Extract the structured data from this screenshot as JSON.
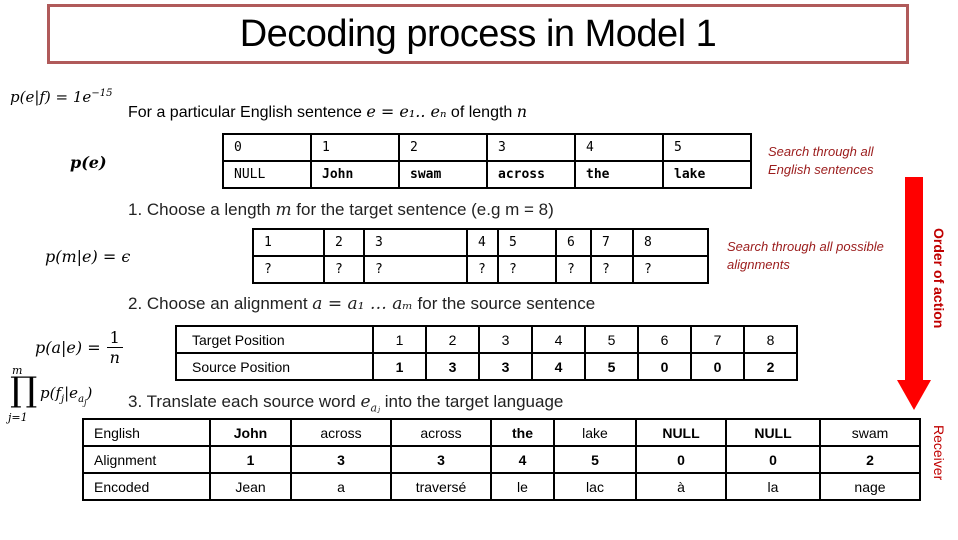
{
  "title": "Decoding process in Model 1",
  "formulas": {
    "p_e_given_f": "p(e|f) = 1e",
    "p_e_given_f_exp": "−15",
    "p_e": "p(e)",
    "p_m_given_e": "p(m|e) = ϵ",
    "p_a_given_e": "p(a|e) =",
    "p_a_num": "1",
    "p_a_den": "n",
    "prod_top": "m",
    "prod_symbol": "∏",
    "prod_bottom": "j=1",
    "prod_term": "p(f",
    "prod_term_sub": "j",
    "prod_term_rest": "|e",
    "prod_term_sub2": "a",
    "prod_term_sub3": "j",
    "prod_term_close": ")"
  },
  "intro": {
    "text": "For a particular English sentence ",
    "math": "e  =  e₁.. eₙ",
    "suffix": " of length ",
    "n": "n"
  },
  "steps": {
    "step1_prefix": "1. Choose a length ",
    "step1_var": "m",
    "step1_suffix": " for the target sentence (e.g m = 8)",
    "step2_prefix": "2. Choose an alignment ",
    "step2_math": "a =  a₁ … aₘ",
    "step2_suffix": " for the source sentence",
    "step3_prefix": "3. Translate each source word ",
    "step3_math": "e",
    "step3_sub": "aⱼ",
    "step3_suffix": " into the target language"
  },
  "english_table": {
    "indices": [
      "0",
      "1",
      "2",
      "3",
      "4",
      "5"
    ],
    "words": [
      "NULL",
      "John",
      "swam",
      "across",
      "the",
      "lake"
    ]
  },
  "length_table": {
    "positions": [
      "1",
      "2",
      "3",
      "4",
      "5",
      "6",
      "7",
      "8"
    ],
    "values": [
      "?",
      "?",
      "?",
      "?",
      "?",
      "?",
      "?",
      "?"
    ]
  },
  "alignment_table": {
    "row1_label": "Target Position",
    "row1": [
      "1",
      "2",
      "3",
      "4",
      "5",
      "6",
      "7",
      "8"
    ],
    "row2_label": "Source Position",
    "row2": [
      "1",
      "3",
      "3",
      "4",
      "5",
      "0",
      "0",
      "2"
    ]
  },
  "translation_table": {
    "english_label": "English",
    "english": [
      "John",
      "across",
      "across",
      "the",
      "lake",
      "NULL",
      "NULL",
      "swam"
    ],
    "alignment_label": "Alignment",
    "alignment": [
      "1",
      "3",
      "3",
      "4",
      "5",
      "0",
      "0",
      "2"
    ],
    "encoded_label": "Encoded",
    "encoded": [
      "Jean",
      "a",
      "traversé",
      "le",
      "lac",
      "à",
      "la",
      "nage"
    ]
  },
  "notes": {
    "search_sentences_1": "Search through all",
    "search_sentences_2": "English sentences",
    "search_alignments_1": "Search through all possible",
    "search_alignments_2": "alignments"
  },
  "side_labels": {
    "order": "Order of action",
    "receiver": "Receiver"
  },
  "colors": {
    "title_border": "#b05a5a",
    "arrow": "#ff0000",
    "note_text": "#9b1c1c"
  }
}
